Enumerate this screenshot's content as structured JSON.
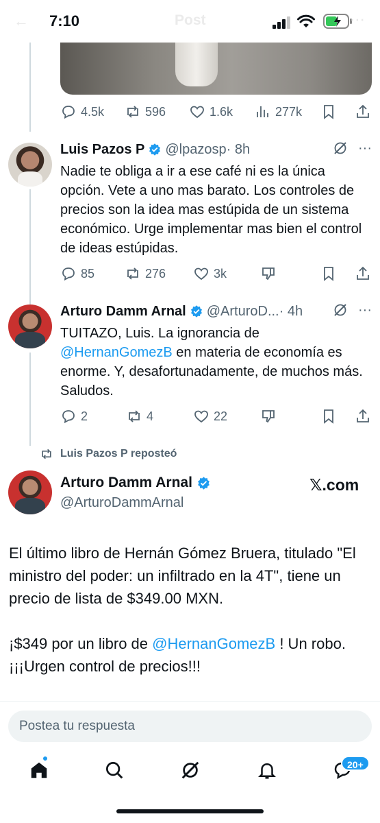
{
  "status_bar": {
    "time": "7:10",
    "ghost_title": "Post"
  },
  "top_tweet": {
    "stats": {
      "replies": "4.5k",
      "reposts": "596",
      "likes": "1.6k",
      "views": "277k"
    }
  },
  "reply1": {
    "name": "Luis Pazos P",
    "handle": "@lpazosp",
    "time": "· 8h",
    "text": "Nadie te obliga a ir a ese café ni es la única opción. Vete a uno mas barato. Los controles de precios son la idea mas estúpida de un sistema económico. Urge implementar mas bien el control de ideas estúpidas.",
    "stats": {
      "replies": "85",
      "reposts": "276",
      "likes": "3k"
    }
  },
  "reply2": {
    "name": "Arturo Damm Arnal",
    "handle": "@ArturoD...",
    "time": "· 4h",
    "text_before": "TUITAZO, Luis. La ignorancia de ",
    "mention": "@HernanGomezB",
    "text_after": " en materia de economía es enorme. Y, desafortunadamente, de muchos más. Saludos.",
    "stats": {
      "replies": "2",
      "reposts": "4",
      "likes": "22"
    }
  },
  "repost": {
    "label": "Luis Pazos P reposteó",
    "name": "Arturo Damm Arnal",
    "handle": "@ArturoDammArnal",
    "source": "𝕏.com",
    "paragraph1": "El último libro de Hernán Gómez Bruera, titulado \"El ministro del poder: un infiltrado en la 4T\", tiene un precio de lista de $349.00 MXN.",
    "p2_before": "¡$349 por un libro de ",
    "p2_mention": "@HernanGomezB",
    "p2_after": " ! Un robo. ¡¡¡Urgen control de precios!!!"
  },
  "reply_box": {
    "placeholder": "Postea tu respuesta"
  },
  "tabbar": {
    "messages_badge": "20+"
  },
  "colors": {
    "accent": "#1d9bf0",
    "text": "#0f1419",
    "secondary": "#536471"
  }
}
